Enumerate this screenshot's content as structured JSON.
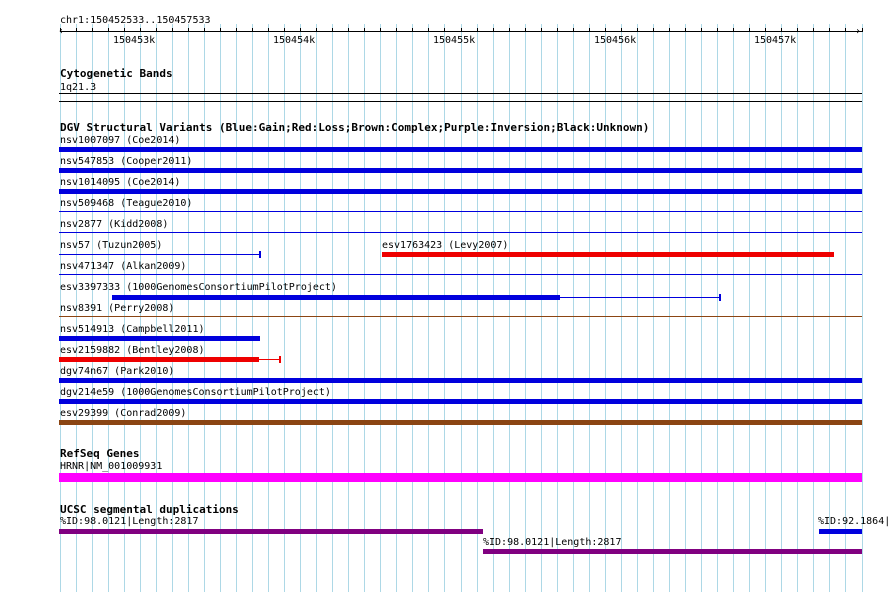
{
  "ruler": {
    "label": "chr1:150452533..150457533",
    "ticks": [
      "150453k",
      "150454k",
      "150455k",
      "150456k",
      "150457k"
    ]
  },
  "tracks": {
    "cyto": {
      "title": "Cytogenetic Bands",
      "band": "1q21.3"
    },
    "dgv": {
      "title": "DGV Structural Variants (Blue:Gain;Red:Loss;Brown:Complex;Purple:Inversion;Black:Unknown)",
      "features": [
        "nsv1007097 (Coe2014)",
        "nsv547853 (Cooper2011)",
        "nsv1014095 (Coe2014)",
        "nsv509468 (Teague2010)",
        "nsv2877 (Kidd2008)",
        "nsv57 (Tuzun2005)",
        "esv1763423 (Levy2007)",
        "nsv471347 (Alkan2009)",
        "esv3397333 (1000GenomesConsortiumPilotProject)",
        "nsv8391 (Perry2008)",
        "nsv514913 (Campbell2011)",
        "esv2159882 (Bentley2008)",
        "dgv74n67 (Park2010)",
        "dgv214e59 (1000GenomesConsortiumPilotProject)",
        "esv29399 (Conrad2009)"
      ]
    },
    "refseq": {
      "title": "RefSeq Genes",
      "gene": "HRNR|NM_001009931"
    },
    "segdup": {
      "title": "UCSC segmental duplications",
      "features": [
        "%ID:98.0121|Length:2817",
        "%ID:98.0121|Length:2817",
        "%ID:92.1864|"
      ]
    }
  },
  "colors": {
    "gain": "#0000dd",
    "loss": "#ee0000",
    "complex": "#8b4513",
    "refseq": "#ff00ff",
    "segdup": "#800080",
    "grid": "#add8e6"
  }
}
